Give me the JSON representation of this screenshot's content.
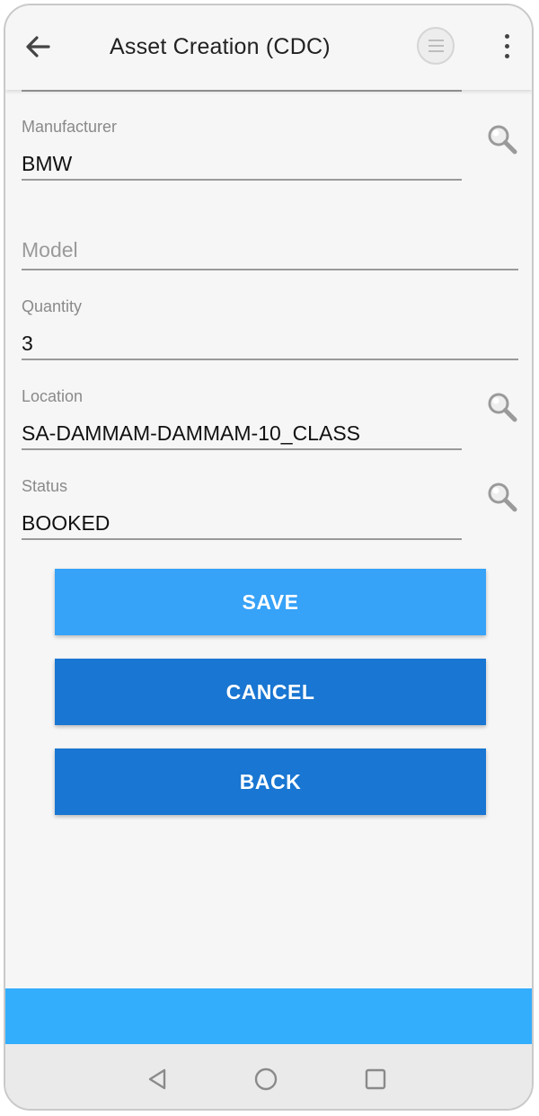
{
  "app_bar": {
    "title": "Asset Creation (CDC)",
    "icons": [
      "arrow-left-icon",
      "list-circle-icon",
      "more-vertical-icon"
    ]
  },
  "form": {
    "manufacturer": {
      "label": "Manufacturer",
      "value": "BMW"
    },
    "model": {
      "placeholder": "Model",
      "value": ""
    },
    "quantity": {
      "label": "Quantity",
      "value": "3"
    },
    "location": {
      "label": "Location",
      "value": "SA-DAMMAM-DAMMAM-10_CLASS"
    },
    "status": {
      "label": "Status",
      "value": "BOOKED"
    }
  },
  "buttons": {
    "save": "SAVE",
    "cancel": "CANCEL",
    "back": "BACK"
  },
  "colors": {
    "save_button": "#36a2f8",
    "primary_button": "#1976d2",
    "footer_bar": "#33aefd",
    "background": "#f6f6f6"
  },
  "system_nav": {
    "icons": [
      "nav-back-triangle-icon",
      "nav-home-circle-icon",
      "nav-recents-square-icon"
    ]
  }
}
